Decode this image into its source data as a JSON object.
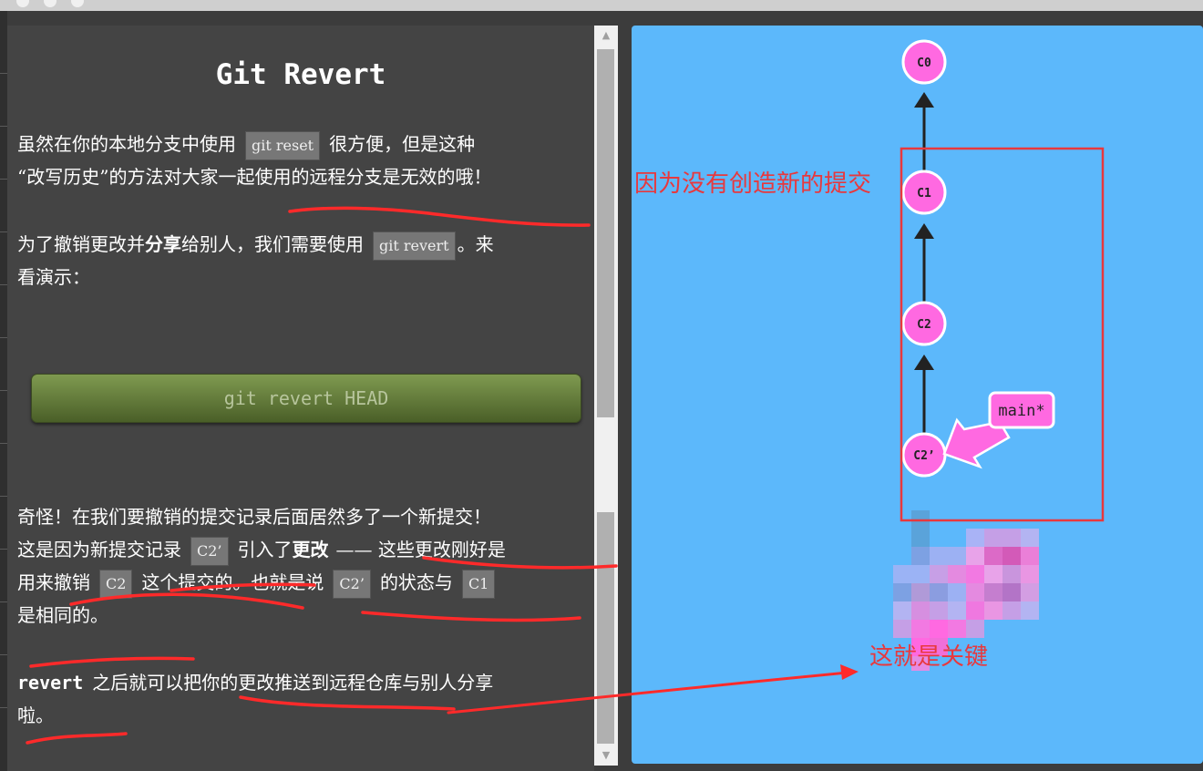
{
  "window": {
    "controls": [
      "close",
      "minimize",
      "maximize"
    ]
  },
  "doc": {
    "title": "Git Revert",
    "p1": {
      "t1": "虽然在你的本地分支中使用",
      "c1": "git reset",
      "t2": "很方便，但是这种",
      "t3": "“改写历史”的方法对大家一起使用的远程分支是无效的哦！"
    },
    "p2": {
      "t1": "为了撤销更改并",
      "b1": "分享",
      "t2": "给别人，我们需要使用",
      "c1": "git revert",
      "t3": "。来",
      "t4": "看演示："
    },
    "command_button": "git revert HEAD",
    "p3": {
      "l1": "奇怪！在我们要撤销的提交记录后面居然多了一个新提交！",
      "t1": "这是因为新提交记录",
      "c1": "C2’",
      "t2": "引入了",
      "b1": "更改",
      "t3": "—— 这些更改刚好是",
      "t4": "用来撤销",
      "c2": "C2",
      "t5": "这个提交的。也就是说",
      "c3": "C2’",
      "t6": "的状态与",
      "c4": "C1",
      "t7": "是相同的。"
    },
    "p4": {
      "b1": "revert",
      "t1": "之后就可以把你的更改推送到远程仓库与别人分享",
      "t2": "啦。"
    }
  },
  "scrollbar": {
    "up": "▲",
    "down": "▼"
  },
  "graph": {
    "commits": [
      "C0",
      "C1",
      "C2",
      "C2’"
    ],
    "branch": {
      "label": "main*",
      "target": "C2’"
    },
    "colors": {
      "background": "#5cb8fb",
      "commit": "#ff69e1",
      "edge": "#222222",
      "annotation": "#e8383d"
    }
  },
  "annotations": {
    "box_note": "因为没有创造新的提交",
    "key_note": "这就是关键"
  }
}
